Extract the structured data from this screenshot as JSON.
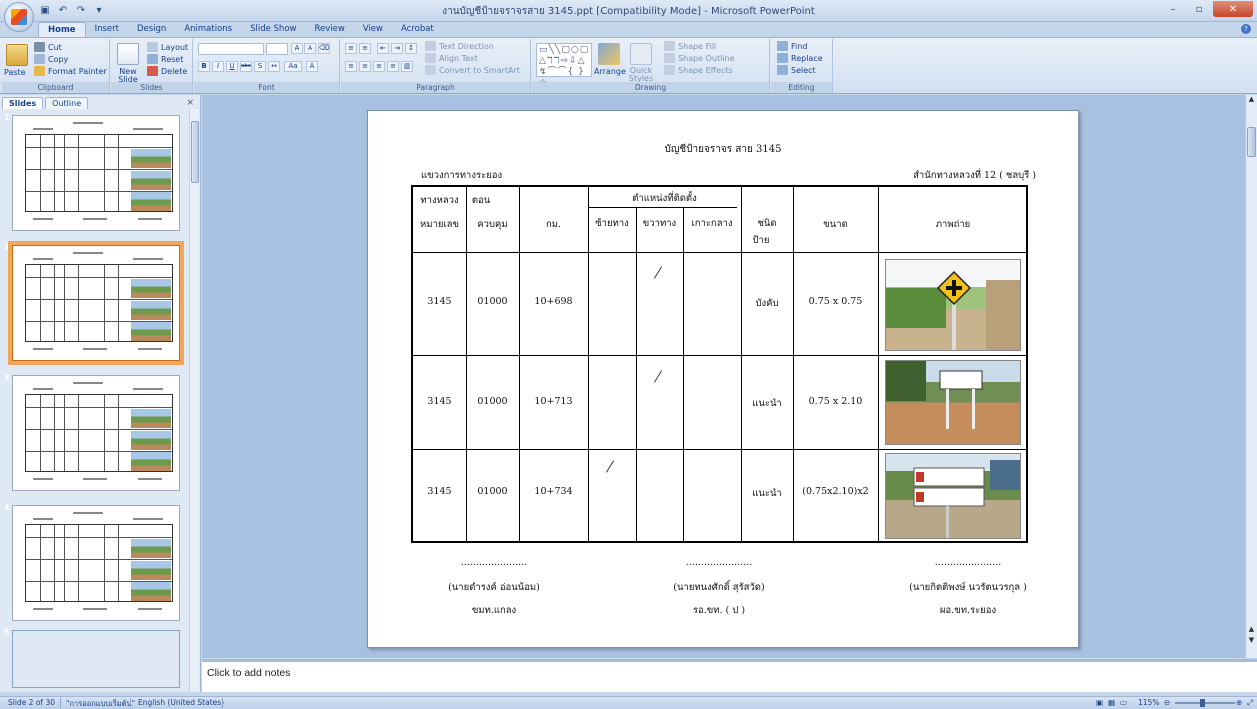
{
  "window": {
    "title": "งานบัญชีป้ายจราจรสาย 3145.ppt [Compatibility Mode] - Microsoft PowerPoint",
    "minimize": "–",
    "maximize": "▫",
    "close": "✕"
  },
  "ribbon": {
    "tabs": [
      "Home",
      "Insert",
      "Design",
      "Animations",
      "Slide Show",
      "Review",
      "View",
      "Acrobat"
    ],
    "active_tab": "Home",
    "clipboard": {
      "paste": "Paste",
      "cut": "Cut",
      "copy": "Copy",
      "format_painter": "Format Painter",
      "label": "Clipboard"
    },
    "slides": {
      "new_slide": "New Slide",
      "layout": "Layout",
      "reset": "Reset",
      "delete": "Delete",
      "label": "Slides"
    },
    "font": {
      "label": "Font",
      "bold": "B",
      "italic": "I",
      "underline": "U",
      "strike": "abc",
      "grow": "A",
      "shrink": "A"
    },
    "paragraph": {
      "label": "Paragraph",
      "text_direction": "Text Direction",
      "align_text": "Align Text",
      "convert_smartart": "Convert to SmartArt"
    },
    "drawing": {
      "label": "Drawing",
      "arrange": "Arrange",
      "quick_styles": "Quick Styles",
      "shape_fill": "Shape Fill",
      "shape_outline": "Shape Outline",
      "shape_effects": "Shape Effects"
    },
    "editing": {
      "label": "Editing",
      "find": "Find",
      "replace": "Replace",
      "select": "Select"
    }
  },
  "left_panel": {
    "tabs": [
      "Slides",
      "Outline"
    ],
    "active_tab": "Slides",
    "close": "×",
    "thumbnails": [
      "1",
      "2",
      "3",
      "4",
      "5"
    ],
    "selected": "2"
  },
  "slide": {
    "title": "บัญชีป้ายจราจร สาย 3145",
    "office_left": "แขวงการทางระยอง",
    "office_right": "สำนักทางหลวงที่ 12 ( ชลบุรี )",
    "headers": {
      "highway_1": "ทางหลวง",
      "highway_2": "หมายเลข",
      "control_1": "ตอน",
      "control_2": "ควบคุม",
      "km": "กม.",
      "position": "ตำแหน่งที่ติดตั้ง",
      "left": "ซ้ายทาง",
      "right": "ขวาทาง",
      "island": "เกาะกลาง",
      "type_1": "ชนิด",
      "type_2": "ป้าย",
      "size": "ขนาด",
      "photo": "ภาพถ่าย"
    },
    "rows": [
      {
        "highway": "3145",
        "control": "01000",
        "km": "10+698",
        "side": "right",
        "type": "บังคับ",
        "size": "0.75  x 0.75"
      },
      {
        "highway": "3145",
        "control": "01000",
        "km": "10+713",
        "side": "right",
        "type": "แนะนำ",
        "size": "0.75  x 2.10"
      },
      {
        "highway": "3145",
        "control": "01000",
        "km": "10+734",
        "side": "left",
        "type": "แนะนำ",
        "size": "(0.75x2.10)x2"
      }
    ],
    "signatures": [
      {
        "dots": "......................",
        "name": "(นายดำรงค์  อ่อนน้อม)",
        "position": "ขมท.แกลง"
      },
      {
        "dots": "......................",
        "name": "(นายทนงศักดิ์  สุรัสวัด)",
        "position": "รอ.ขท. ( ป )"
      },
      {
        "dots": "......................",
        "name": "(นายกิตติพงษ์  นวรัตนวรกุล )",
        "position": "ผอ.ขท.ระยอง"
      }
    ]
  },
  "notes": {
    "placeholder": "Click to add notes"
  },
  "status": {
    "slide_info": "Slide 2 of 30",
    "theme": "\"การออกแบบเริ่มต้น\"",
    "language": "English (United States)",
    "zoom": "115%"
  },
  "colors": {
    "ribbon_bg": "#d3e0f1",
    "workspace": "#a9c1e0",
    "selected_thumb": "#f0a858",
    "close_button": "#c4452b"
  }
}
